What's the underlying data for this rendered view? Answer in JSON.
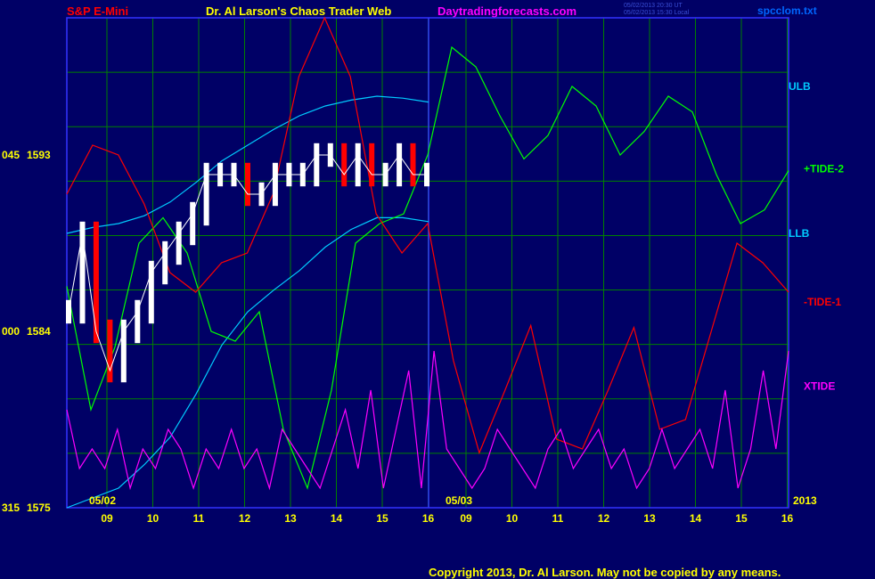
{
  "header": {
    "instrument": "S&P E-Mini",
    "site_title": "Dr. Al Larson's Chaos Trader Web",
    "url": "Daytradingforecasts.com",
    "timestamp_1": "05/02/2013 20:30 UT",
    "timestamp_2": "05/02/2013 15:30 Local",
    "file": "spcclom.txt"
  },
  "colors": {
    "background": "#000066",
    "grid": "#008000",
    "frame": "#3333ff",
    "price_up": "#ffffff",
    "price_down": "#ff0000",
    "ulb_llb": "#00ccff",
    "tide2": "#00ff00",
    "tide1": "#ff0000",
    "xtide": "#ff00ff"
  },
  "chart_data": {
    "type": "line",
    "x_ticks": [
      "09",
      "10",
      "11",
      "12",
      "13",
      "14",
      "15",
      "16",
      "09",
      "10",
      "11",
      "12",
      "13",
      "14",
      "15",
      "16"
    ],
    "date_markers": [
      "05/02",
      "05/03",
      "2013"
    ],
    "y_ticks_left": [
      {
        "angle": "045",
        "price": "1593"
      },
      {
        "angle": "000",
        "price": "1584"
      },
      {
        "angle": "315",
        "price": "1575"
      }
    ],
    "ylim": [
      1575,
      1600
    ],
    "series_labels": [
      "ULB",
      "+TIDE-2",
      "LLB",
      "-TIDE-1",
      "XTIDE"
    ],
    "price_close": [
      1585,
      1589,
      1584,
      1582,
      1584,
      1585,
      1587,
      1588,
      1589,
      1590,
      1592,
      1592,
      1592,
      1591,
      1591,
      1592,
      1592,
      1592,
      1593,
      1593,
      1592,
      1593,
      1592,
      1592,
      1593,
      1592,
      1592
    ],
    "ulb": [
      1589.0,
      1589.3,
      1589.5,
      1589.9,
      1590.6,
      1591.6,
      1592.7,
      1593.5,
      1594.3,
      1595.0,
      1595.5,
      1595.8,
      1596.0,
      1595.9,
      1595.7
    ],
    "llb": [
      1575.0,
      1575.5,
      1576.0,
      1577.2,
      1578.6,
      1580.8,
      1583.3,
      1585.0,
      1586.1,
      1587.1,
      1588.3,
      1589.2,
      1589.8,
      1589.8,
      1589.6
    ],
    "tide2": [
      1586.3,
      1580.0,
      1583.2,
      1588.5,
      1589.8,
      1588.0,
      1584.0,
      1583.5,
      1585.0,
      1579.0,
      1576.0,
      1581.0,
      1588.5,
      1589.5,
      1590.0,
      1593.0,
      1598.5,
      1597.5,
      1595.0,
      1592.8,
      1594.0,
      1596.5,
      1595.5,
      1593.0,
      1594.2,
      1596.0,
      1595.2,
      1592.0,
      1589.5,
      1590.2,
      1592.2
    ],
    "tide1": [
      1591.0,
      1593.5,
      1593.0,
      1590.5,
      1587.0,
      1586.0,
      1587.5,
      1588.0,
      1591.0,
      1597.0,
      1600.0,
      1597.0,
      1590.0,
      1588.0,
      1589.5,
      1582.5,
      1577.8,
      1581.0,
      1584.3,
      1578.5,
      1578.0,
      1581.0,
      1584.2,
      1579.0,
      1579.5,
      1584.0,
      1588.5,
      1587.5,
      1586.0
    ],
    "xtide": [
      1580,
      1577,
      1578,
      1577,
      1579,
      1576,
      1578,
      1577,
      1579,
      1578,
      1576,
      1578,
      1577,
      1579,
      1577,
      1578,
      1576,
      1579,
      1578,
      1577,
      1576,
      1578,
      1580,
      1577,
      1581,
      1576,
      1579,
      1582,
      1576,
      1583,
      1578,
      1577,
      1576,
      1577,
      1579,
      1578,
      1577,
      1576,
      1578,
      1579,
      1577,
      1578,
      1579,
      1577,
      1578,
      1576,
      1577,
      1579,
      1577,
      1578,
      1579,
      1577,
      1581,
      1576,
      1578,
      1582,
      1578,
      1583
    ]
  },
  "copyright": "Copyright 2013, Dr. Al Larson. May not be copied by any means."
}
